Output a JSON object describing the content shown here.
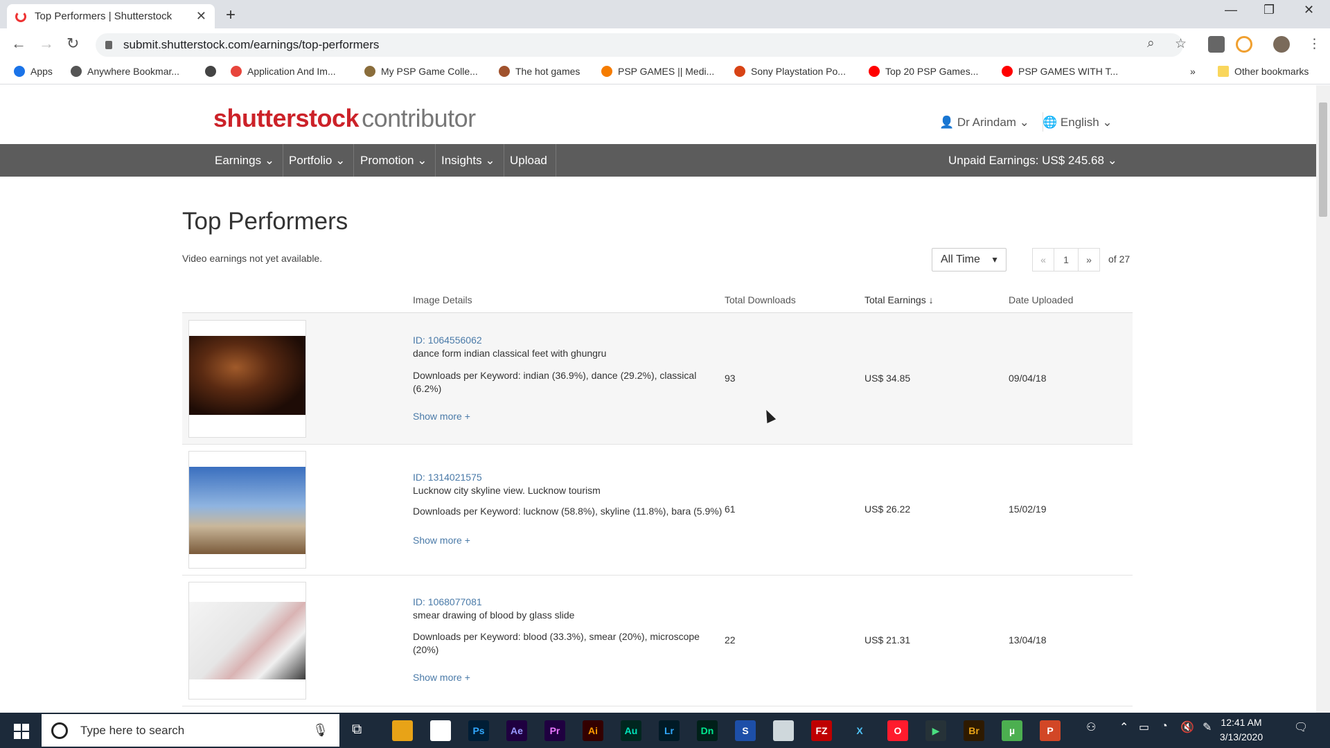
{
  "browser": {
    "tab_title": "Top Performers | Shutterstock",
    "url": "submit.shutterstock.com/earnings/top-performers",
    "bookmarks": [
      {
        "label": "Apps",
        "color": "#1a73e8"
      },
      {
        "label": "Anywhere Bookmar...",
        "color": "#555555"
      },
      {
        "label": "",
        "color": "#444444"
      },
      {
        "label": "Application And Im...",
        "color": "#e8453c"
      },
      {
        "label": "My PSP Game Colle...",
        "color": "#8a6d3b"
      },
      {
        "label": "The hot games",
        "color": "#a0522d"
      },
      {
        "label": "PSP GAMES || Medi...",
        "color": "#f57c00"
      },
      {
        "label": "Sony Playstation Po...",
        "color": "#d84315"
      },
      {
        "label": "Top 20 PSP Games...",
        "color": "#ff0000"
      },
      {
        "label": "PSP GAMES WITH T...",
        "color": "#ff0000"
      }
    ],
    "bookmarks_overflow": "»",
    "other_bookmarks": "Other bookmarks"
  },
  "site": {
    "logo_brand": "shutterstock",
    "logo_sub": "contributor",
    "user": "Dr Arindam",
    "language": "English",
    "nav": [
      "Earnings",
      "Portfolio",
      "Promotion",
      "Insights",
      "Upload"
    ],
    "unpaid_earnings": "Unpaid Earnings: US$ 245.68"
  },
  "main": {
    "title": "Top Performers",
    "note": "Video earnings not yet available.",
    "period": "All Time",
    "pager": {
      "prev": "«",
      "page": "1",
      "next": "»",
      "of": "of 27"
    },
    "columns": {
      "details": "Image Details",
      "downloads": "Total Downloads",
      "earnings": "Total Earnings",
      "uploaded": "Date Uploaded"
    },
    "rows": [
      {
        "id": "ID: 1064556062",
        "description": "dance form indian classical feet with ghungru",
        "keywords": "Downloads per Keyword: indian (36.9%), dance (29.2%), classical (6.2%)",
        "show_more": "Show more +",
        "downloads": "93",
        "earnings": "US$ 34.85",
        "uploaded": "09/04/18"
      },
      {
        "id": "ID: 1314021575",
        "description": "Lucknow city skyline view. Lucknow tourism",
        "keywords": "Downloads per Keyword: lucknow (58.8%), skyline (11.8%), bara (5.9%)",
        "show_more": "Show more +",
        "downloads": "61",
        "earnings": "US$ 26.22",
        "uploaded": "15/02/19"
      },
      {
        "id": "ID: 1068077081",
        "description": "smear drawing of blood by glass slide",
        "keywords": "Downloads per Keyword: blood (33.3%), smear (20%), microscope (20%)",
        "show_more": "Show more +",
        "downloads": "22",
        "earnings": "US$ 21.31",
        "uploaded": "13/04/18"
      }
    ]
  },
  "taskbar": {
    "search_placeholder": "Type here to search",
    "apps": [
      {
        "label": "",
        "bg": "#e8a317",
        "fg": "#000000"
      },
      {
        "label": "",
        "bg": "#ffffff",
        "fg": "#000000"
      },
      {
        "label": "Ps",
        "bg": "#001e36",
        "fg": "#31a8ff"
      },
      {
        "label": "Ae",
        "bg": "#1f0040",
        "fg": "#9999ff"
      },
      {
        "label": "Pr",
        "bg": "#1f0040",
        "fg": "#ea77ff"
      },
      {
        "label": "Ai",
        "bg": "#330000",
        "fg": "#ff9a00"
      },
      {
        "label": "Au",
        "bg": "#00261f",
        "fg": "#00e4bb"
      },
      {
        "label": "Lr",
        "bg": "#001a26",
        "fg": "#31a8ff"
      },
      {
        "label": "Dn",
        "bg": "#002019",
        "fg": "#00e88f"
      },
      {
        "label": "S",
        "bg": "#1d4fa8",
        "fg": "#ffffff"
      },
      {
        "label": "",
        "bg": "#cfd8dc",
        "fg": "#000000"
      },
      {
        "label": "FZ",
        "bg": "#bf0000",
        "fg": "#ffffff"
      },
      {
        "label": "X",
        "bg": "#1c2a3a",
        "fg": "#4fc3f7"
      },
      {
        "label": "O",
        "bg": "#ff1b2d",
        "fg": "#ffffff"
      },
      {
        "label": "▶",
        "bg": "#263238",
        "fg": "#4ade80"
      },
      {
        "label": "Br",
        "bg": "#2e1a00",
        "fg": "#e8a317"
      },
      {
        "label": "µ",
        "bg": "#4caf50",
        "fg": "#ffffff"
      },
      {
        "label": "P",
        "bg": "#d24726",
        "fg": "#ffffff"
      }
    ],
    "time": "12:41 AM",
    "date": "3/13/2020"
  }
}
